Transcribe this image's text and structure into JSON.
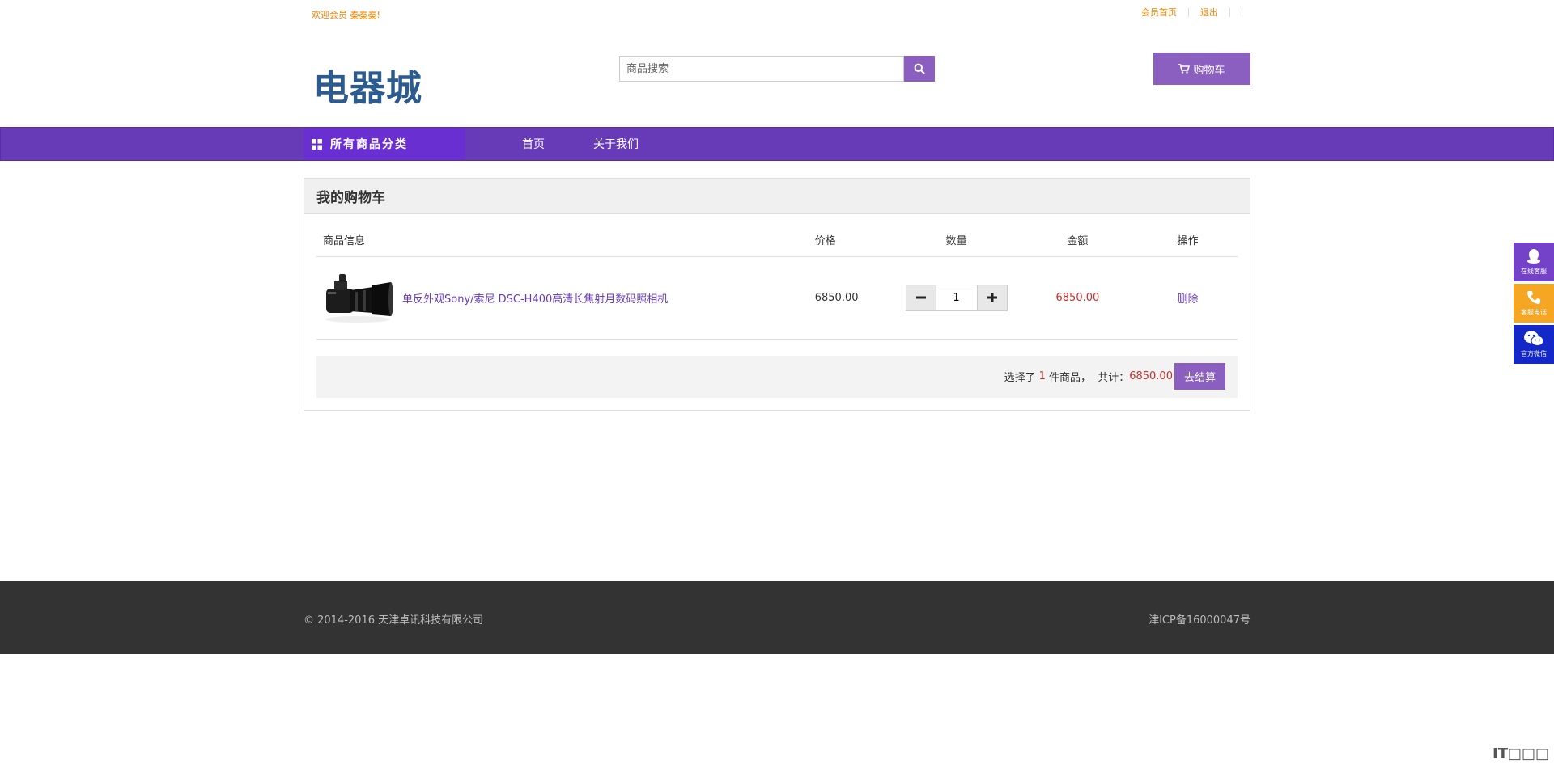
{
  "topbar": {
    "welcome_prefix": "欢迎会员",
    "username": "秦秦秦",
    "welcome_suffix": "!",
    "links": [
      "会员首页",
      "退出"
    ]
  },
  "header": {
    "logo": "电器城",
    "search_placeholder": "商品搜索",
    "cart_label": "购物车"
  },
  "nav": {
    "category_label": "所有商品分类",
    "links": [
      "首页",
      "关于我们"
    ]
  },
  "cart": {
    "title": "我的购物车",
    "columns": {
      "info": "商品信息",
      "price": "价格",
      "qty": "数量",
      "amount": "金额",
      "action": "操作"
    },
    "items": [
      {
        "name": "单反外观Sony/索尼 DSC-H400高清长焦射月数码照相机",
        "price": "6850.00",
        "qty": "1",
        "amount": "6850.00",
        "action": "删除"
      }
    ],
    "summary": {
      "selected_prefix": "选择了",
      "count": "1",
      "selected_suffix": "件商品，  共计：",
      "total": "6850.00",
      "checkout_label": "去结算"
    }
  },
  "footer": {
    "copyright": "© 2014-2016 天津卓讯科技有限公司",
    "icp": "津ICP备16000047号"
  },
  "side": {
    "qq": "在线客服",
    "phone": "客服电话",
    "wechat": "官方微信"
  },
  "watermark": "IT□□□",
  "colors": {
    "accent": "#673ab7",
    "button": "#8a5fbf",
    "price_red": "#c9302c",
    "orange": "#f08300"
  }
}
